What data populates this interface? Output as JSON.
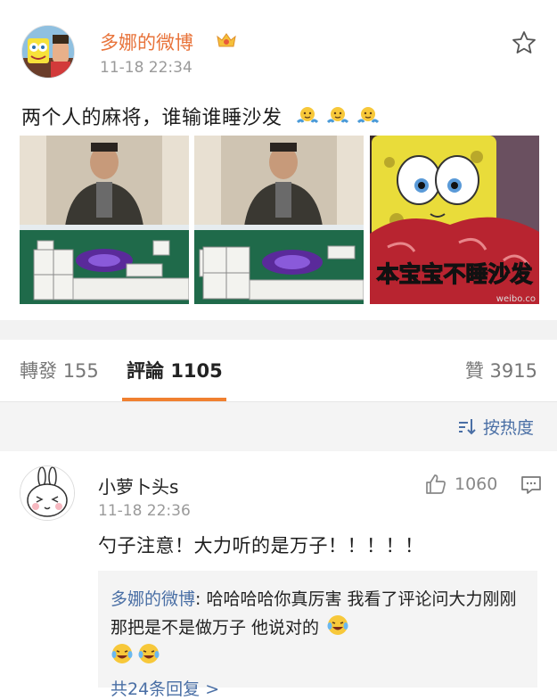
{
  "post": {
    "author": "多娜的微博",
    "time": "11-18 22:34",
    "text": "两个人的麻将，谁输谁睡沙发",
    "emojis": [
      "shrug-emoji",
      "shrug-emoji",
      "shrug-emoji"
    ],
    "image_caption": "本宝宝不睡沙发",
    "image_watermark": "weibo.co"
  },
  "tabs": {
    "repost_label": "轉發",
    "repost_count": "155",
    "comments_label": "評論",
    "comments_count": "1105",
    "likes_label": "贊",
    "likes_count": "3915"
  },
  "sort": {
    "label": "按热度"
  },
  "comment": {
    "author": "小萝卜头s",
    "time": "11-18 22:36",
    "likes": "1060",
    "text": "勺子注意！大力听的是万子！！！！！",
    "reply": {
      "author": "多娜的微博",
      "text": ": 哈哈哈哈你真厉害 我看了评论问大力刚刚那把是不是做万子 他说对的",
      "count_label": "共24条回复 >"
    }
  },
  "colors": {
    "accent_orange": "#f08030",
    "author_orange": "#e8733a",
    "link_blue": "#4a6fa5",
    "muted_gray": "#9a9a9a"
  }
}
